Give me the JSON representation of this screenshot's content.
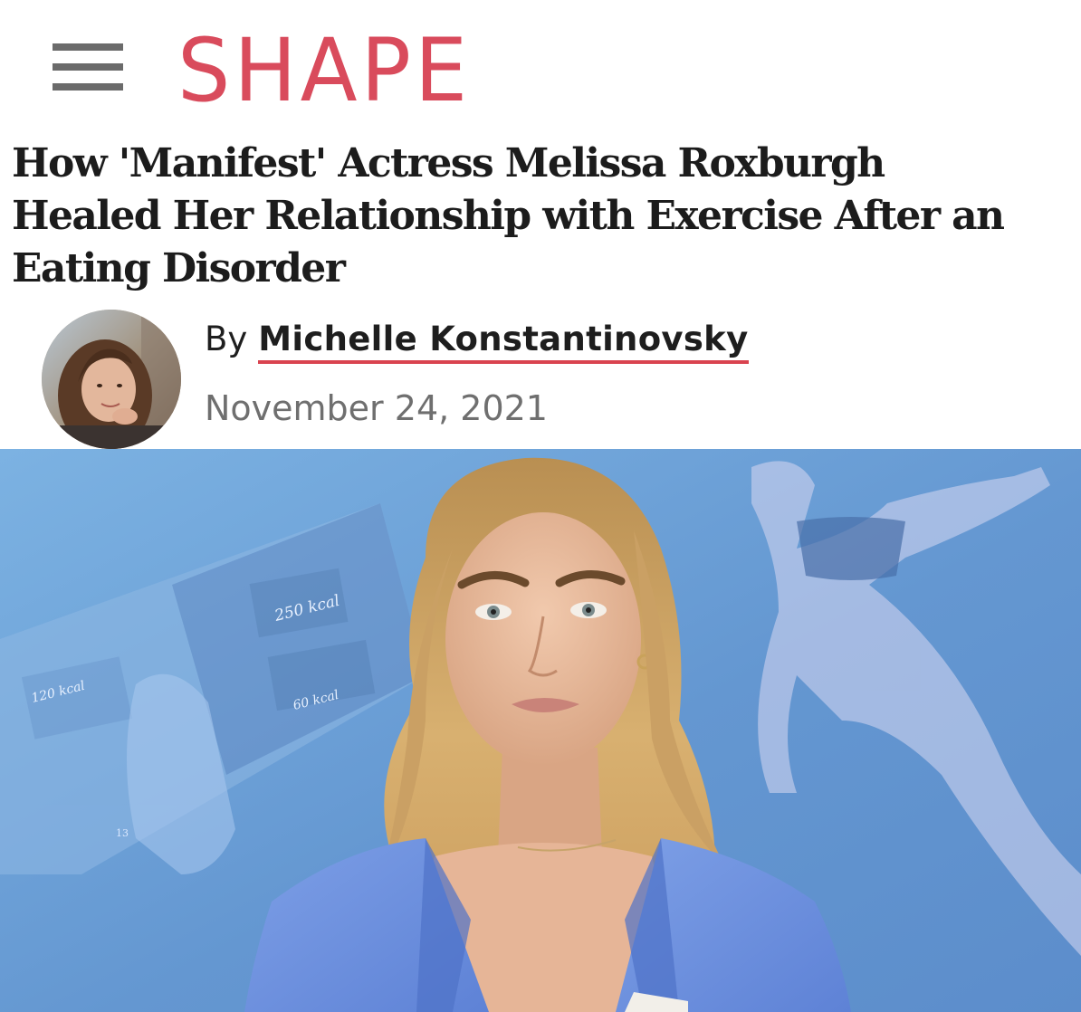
{
  "header": {
    "menu_icon": "hamburger-menu-icon",
    "logo_text": "SHAPE",
    "brand_color": "#d94b5c"
  },
  "article": {
    "headline_lines": [
      "How 'Manifest' Actress Melissa Roxburgh",
      "Healed Her Relationship with Exercise After an",
      "Eating Disorder"
    ],
    "byline_prefix": "By",
    "author_name": "Michelle Konstantinovsky",
    "date": "November 24, 2021",
    "author_underline_color": "#d9434f"
  },
  "hero": {
    "background_color": "#6a9fd6",
    "kcal_labels": [
      "250 kcal",
      "120 kcal",
      "60 kcal"
    ],
    "page_number": "13"
  }
}
